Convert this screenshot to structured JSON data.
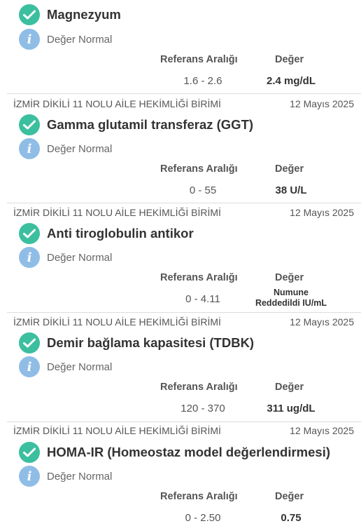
{
  "columns": {
    "reference": "Referans Aralığı",
    "value": "Değer"
  },
  "cards": [
    {
      "institution": "",
      "date": "",
      "title": "Magnezyum",
      "status": "Değer Normal",
      "reference_range": "1.6 - 2.6",
      "value": "2.4  mg/dL"
    },
    {
      "institution": "İZMİR DİKİLİ 11 NOLU AİLE HEKİMLİĞİ BİRİMİ",
      "date": "12 Mayıs 2025",
      "title": "Gamma glutamil transferaz (GGT)",
      "status": "Değer Normal",
      "reference_range": "0 - 55",
      "value": "38  U/L"
    },
    {
      "institution": "İZMİR DİKİLİ 11 NOLU AİLE HEKİMLİĞİ BİRİMİ",
      "date": "12 Mayıs 2025",
      "title": "Anti tiroglobulin antikor",
      "status": "Değer Normal",
      "reference_range": "0 - 4.11",
      "value_line1": "Numune",
      "value_line2": "Reddedildi IU/mL"
    },
    {
      "institution": "İZMİR DİKİLİ 11 NOLU AİLE HEKİMLİĞİ BİRİMİ",
      "date": "12 Mayıs 2025",
      "title": "Demir bağlama kapasitesi (TDBK)",
      "status": "Değer Normal",
      "reference_range": "120 - 370",
      "value": "311  ug/dL"
    },
    {
      "institution": "İZMİR DİKİLİ 11 NOLU AİLE HEKİMLİĞİ BİRİMİ",
      "date": "12 Mayıs 2025",
      "title": "HOMA-IR (Homeostaz model değerlendirmesi)",
      "status": "Değer Normal",
      "reference_range": "0 - 2.50",
      "value": "0.75"
    }
  ],
  "icons": {
    "check": "check-circle-icon",
    "info": "info-icon"
  },
  "colors": {
    "check": "#3bbf9f",
    "info": "#8fbde6",
    "divider": "#dddddd"
  }
}
